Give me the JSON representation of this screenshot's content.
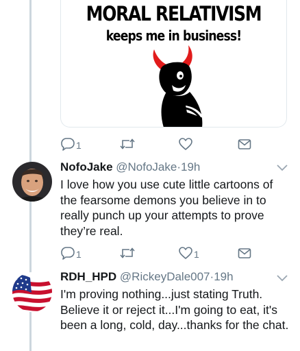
{
  "meme": {
    "line1": "MORAL RELATIVISM",
    "line2": "keeps me in business!"
  },
  "first_actions": {
    "reply_count": "1",
    "retweet_count": "",
    "like_count": ""
  },
  "tweets": [
    {
      "display_name": "NofoJake",
      "handle": "@NofoJake",
      "separator": "·",
      "time": "19h",
      "text": "I love how you use cute little cartoons of the fearsome demons you believe in to really punch up your attempts to prove they’re real.",
      "reply_count": "1",
      "retweet_count": "",
      "like_count": "1"
    },
    {
      "display_name": "RDH_HPD",
      "handle": "@RickeyDale007",
      "separator": "·",
      "time": "19h",
      "text": "I'm proving nothing...just stating Truth. Believe it or reject it...I'm going to eat, it's been a long, cold, day...thanks for the chat.",
      "reply_count": "",
      "retweet_count": "",
      "like_count": ""
    }
  ],
  "colors": {
    "text": "#14171a",
    "secondary": "#657786",
    "thread_line": "#ccd6dd",
    "devil_red": "#e11b1b"
  }
}
